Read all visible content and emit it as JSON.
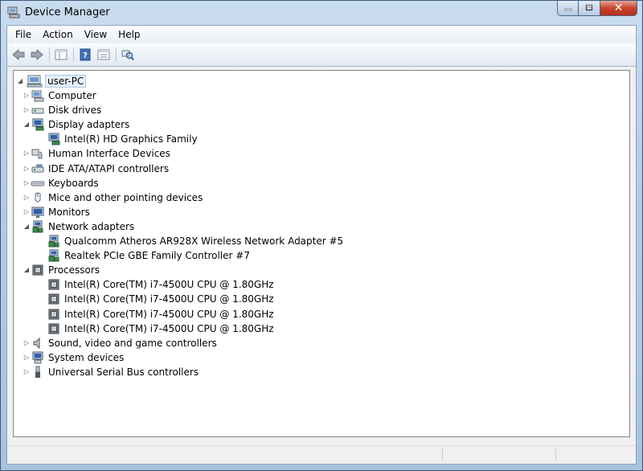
{
  "window": {
    "title": "Device Manager",
    "close_glyph": "✕"
  },
  "menu": [
    "File",
    "Action",
    "View",
    "Help"
  ],
  "toolbar": {
    "icons": [
      "back-arrow-icon",
      "forward-arrow-icon",
      "show-hide-console-tree-icon",
      "help-icon",
      "properties-icon",
      "scan-hardware-changes-icon"
    ]
  },
  "tree": {
    "root": {
      "label": "user-PC",
      "expanded": true
    },
    "items": [
      {
        "label": "Computer",
        "level": 1,
        "expander": "collapsed",
        "icon": "computer-icon"
      },
      {
        "label": "Disk drives",
        "level": 1,
        "expander": "collapsed",
        "icon": "disk-drive-icon"
      },
      {
        "label": "Display adapters",
        "level": 1,
        "expander": "expanded",
        "icon": "display-adapter-icon"
      },
      {
        "label": "Intel(R) HD Graphics Family",
        "level": 2,
        "expander": "none",
        "icon": "display-adapter-icon"
      },
      {
        "label": "Human Interface Devices",
        "level": 1,
        "expander": "collapsed",
        "icon": "hid-icon"
      },
      {
        "label": "IDE ATA/ATAPI controllers",
        "level": 1,
        "expander": "collapsed",
        "icon": "ide-controller-icon"
      },
      {
        "label": "Keyboards",
        "level": 1,
        "expander": "collapsed",
        "icon": "keyboard-icon"
      },
      {
        "label": "Mice and other pointing devices",
        "level": 1,
        "expander": "collapsed",
        "icon": "mouse-icon"
      },
      {
        "label": "Monitors",
        "level": 1,
        "expander": "collapsed",
        "icon": "monitor-icon"
      },
      {
        "label": "Network adapters",
        "level": 1,
        "expander": "expanded",
        "icon": "network-adapter-icon"
      },
      {
        "label": "Qualcomm Atheros AR928X Wireless Network Adapter #5",
        "level": 2,
        "expander": "none",
        "icon": "network-adapter-icon"
      },
      {
        "label": "Realtek PCIe GBE Family Controller #7",
        "level": 2,
        "expander": "none",
        "icon": "network-adapter-icon"
      },
      {
        "label": "Processors",
        "level": 1,
        "expander": "expanded",
        "icon": "processor-icon"
      },
      {
        "label": "Intel(R) Core(TM) i7-4500U CPU @ 1.80GHz",
        "level": 2,
        "expander": "none",
        "icon": "processor-icon"
      },
      {
        "label": "Intel(R) Core(TM) i7-4500U CPU @ 1.80GHz",
        "level": 2,
        "expander": "none",
        "icon": "processor-icon"
      },
      {
        "label": "Intel(R) Core(TM) i7-4500U CPU @ 1.80GHz",
        "level": 2,
        "expander": "none",
        "icon": "processor-icon"
      },
      {
        "label": "Intel(R) Core(TM) i7-4500U CPU @ 1.80GHz",
        "level": 2,
        "expander": "none",
        "icon": "processor-icon"
      },
      {
        "label": "Sound, video and game controllers",
        "level": 1,
        "expander": "collapsed",
        "icon": "speaker-icon"
      },
      {
        "label": "System devices",
        "level": 1,
        "expander": "collapsed",
        "icon": "system-devices-icon"
      },
      {
        "label": "Universal Serial Bus controllers",
        "level": 1,
        "expander": "collapsed",
        "icon": "usb-icon"
      }
    ]
  },
  "statusbar": {
    "text": ""
  }
}
